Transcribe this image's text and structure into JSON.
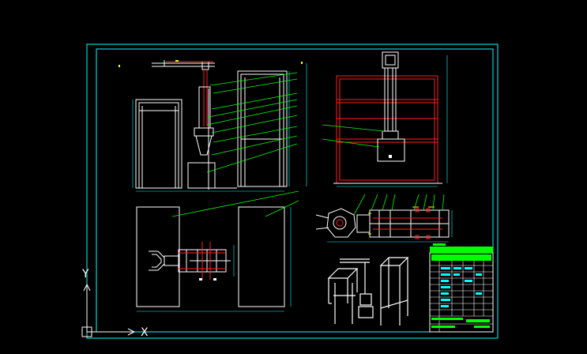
{
  "ucs": {
    "x_label": "X",
    "y_label": "Y"
  },
  "colors": {
    "background": "#000000",
    "border": "#00ffff",
    "frame": "#ffffff",
    "structure": "#ff2020",
    "leader": "#00ff00",
    "dimension": "#00ffff",
    "accent": "#ffff00",
    "title_block_fill": "#00ff00"
  },
  "icons": [
    "ucs-icon"
  ]
}
